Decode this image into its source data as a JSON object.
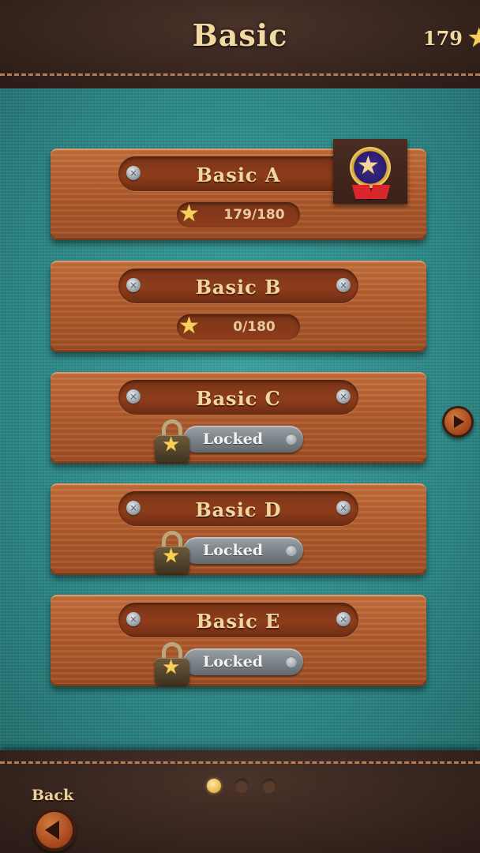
{
  "header": {
    "title": "Basic",
    "star_total": "179",
    "star_icon": "star-icon"
  },
  "levels": [
    {
      "name": "Basic A",
      "status": "completed",
      "progress": "179/180",
      "badge": "medal-icon"
    },
    {
      "name": "Basic B",
      "status": "unlocked",
      "progress": "0/180"
    },
    {
      "name": "Basic C",
      "status": "locked",
      "locked_label": "Locked"
    },
    {
      "name": "Basic D",
      "status": "locked",
      "locked_label": "Locked"
    },
    {
      "name": "Basic E",
      "status": "locked",
      "locked_label": "Locked"
    }
  ],
  "pagination": {
    "pages": 3,
    "current": 1
  },
  "footer": {
    "back_label": "Back"
  },
  "colors": {
    "board": "#2f8f8d",
    "wood": "#b25c2d",
    "leather": "#33221c",
    "gold": "#f2d9a1",
    "star": "#f6d05a"
  }
}
